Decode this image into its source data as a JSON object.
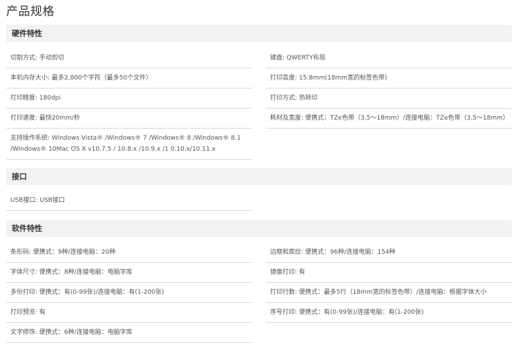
{
  "page_title": "产品规格",
  "sections": {
    "hardware": {
      "title": "硬件特性",
      "left": [
        "切割方式: 手动剪切",
        "本机内存大小: 最多2,800个字符（最多50个文件）",
        "打印精度: 180dpi",
        "打印速度: 最快20mm/秒",
        "支持操作系统: Windows Vista® /Windows® 7 /Windows® 8 /Windows® 8.1 /Windows® 10Mac OS X v10.7.5 / 10.8.x /10.9.x /1 0.10.x/10.11.x"
      ],
      "right": [
        "键盘: QWERTY布局",
        "打印高度: 15.8mm(18mm宽的标签色带)",
        "打印方式: 热转印",
        "耗材及宽度: 便携式：TZe色带（3.5～18mm）/连接电脑：TZe色带（3.5～18mm）"
      ]
    },
    "interface": {
      "title": "接口",
      "left": [
        "USB接口: USB接口"
      ]
    },
    "software": {
      "title": "软件特性",
      "left": [
        "条形码: 便携式：9种/连接电脑：20种",
        "字体尺寸: 便携式：8种/连接电脑：电脑字库",
        "多份打印: 便携式：有(0-99张)/连接电脑：有(1-200张)",
        "打印预览: 有",
        "文字修饰: 便携式：6种/连接电脑：电脑字库"
      ],
      "right": [
        "边框和底纹: 便携式：96种/连接电脑：154种",
        "镜像打印: 有",
        "打印行数: 便携式：最多5行（18mm宽的标签色带）/连接电脑：根据字体大小",
        "序号打印: 便携式：有(0-99张)/连接电脑：有(1-200张)"
      ]
    }
  }
}
